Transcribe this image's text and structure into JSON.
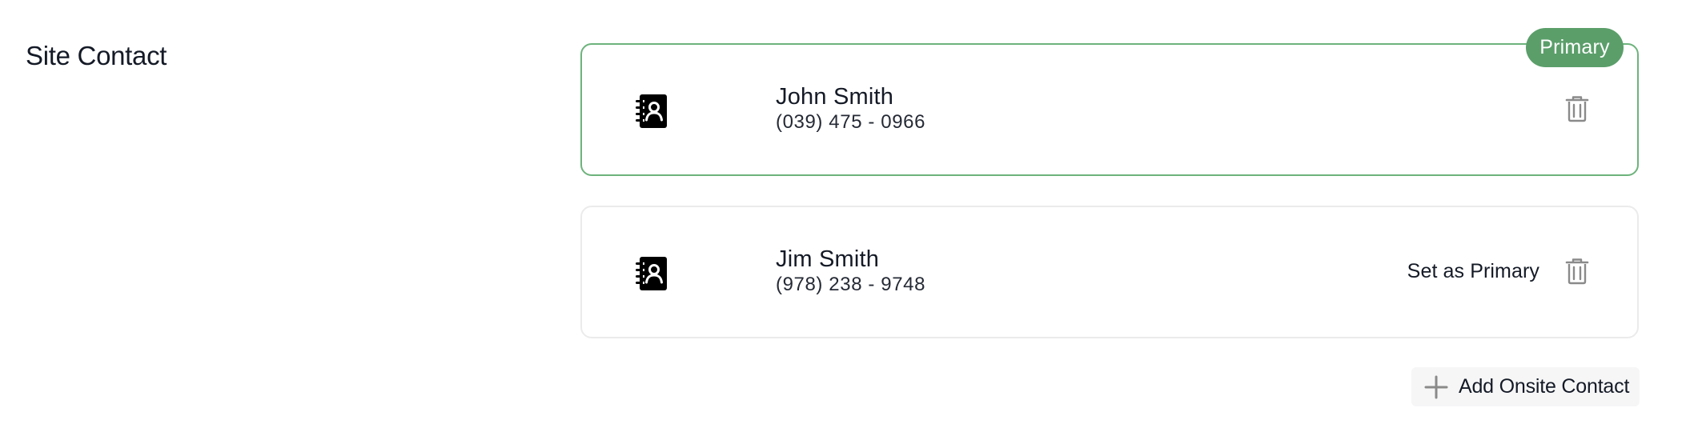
{
  "section": {
    "title": "Site Contact"
  },
  "contacts": [
    {
      "name": "John Smith",
      "phone": "(039) 475 - 0966",
      "is_primary": true,
      "badge_label": "Primary"
    },
    {
      "name": "Jim Smith",
      "phone": "(978) 238 - 9748",
      "is_primary": false,
      "set_primary_label": "Set as Primary"
    }
  ],
  "actions": {
    "add_contact_label": "Add Onsite Contact"
  },
  "icons": {
    "contact_book": "address-book-icon",
    "delete": "trash-icon",
    "add": "plus-icon"
  },
  "colors": {
    "primary_border": "#6db37c",
    "primary_badge": "#5b9e6a",
    "card_border": "#ebebeb",
    "icon_gray": "#8a8a8a",
    "text": "#141a26"
  }
}
